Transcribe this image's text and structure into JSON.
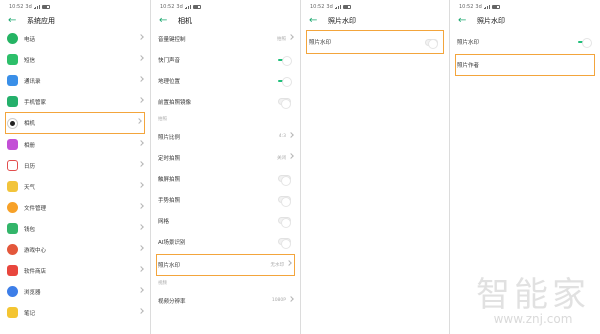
{
  "status": {
    "time": "10:52",
    "network": "3d"
  },
  "screen1": {
    "title": "系统应用",
    "items": [
      {
        "label": "电话",
        "icon": "phone-icon",
        "color": "#25b464"
      },
      {
        "label": "短信",
        "icon": "message-icon",
        "color": "#2dbf6a"
      },
      {
        "label": "通讯录",
        "icon": "contacts-icon",
        "color": "#3a8fe8"
      },
      {
        "label": "手机管家",
        "icon": "shield-icon",
        "color": "#24b06b"
      },
      {
        "label": "相机",
        "icon": "camera-icon",
        "color": "#222222"
      },
      {
        "label": "相册",
        "icon": "gallery-icon",
        "color": "#c34fd6"
      },
      {
        "label": "日历",
        "icon": "calendar-icon",
        "color": "#e24e4e"
      },
      {
        "label": "天气",
        "icon": "weather-icon",
        "color": "#f2c43b"
      },
      {
        "label": "文件管理",
        "icon": "folder-icon",
        "color": "#f7a128"
      },
      {
        "label": "钱包",
        "icon": "wallet-icon",
        "color": "#33b56a"
      },
      {
        "label": "游戏中心",
        "icon": "game-icon",
        "color": "#e3573b"
      },
      {
        "label": "软件商店",
        "icon": "store-icon",
        "color": "#e8463d"
      },
      {
        "label": "浏览器",
        "icon": "browser-icon",
        "color": "#3d7ee8"
      },
      {
        "label": "笔记",
        "icon": "notes-icon",
        "color": "#f4c532"
      }
    ]
  },
  "screen2": {
    "title": "相机",
    "items": [
      {
        "label": "音量键控制",
        "value": "拍照"
      },
      {
        "label": "快门声音"
      },
      {
        "label": "地理位置"
      },
      {
        "label": "前置拍照镜像"
      }
    ],
    "section": "拍照",
    "items2": [
      {
        "label": "照片比例",
        "value": "4:3"
      },
      {
        "label": "定时拍照",
        "value": "关闭"
      },
      {
        "label": "触屏拍照"
      },
      {
        "label": "手势拍照"
      },
      {
        "label": "网格"
      },
      {
        "label": "AI场景识别"
      },
      {
        "label": "照片水印",
        "value": "无水印"
      }
    ],
    "section2": "视频",
    "items3": [
      {
        "label": "视频分辨率",
        "value": "1080P"
      }
    ]
  },
  "screen3": {
    "title": "照片水印",
    "item": "照片水印"
  },
  "screen4": {
    "title": "照片水印",
    "item": "照片水印",
    "author": "照片作者"
  },
  "watermark": {
    "main": "智能家",
    "sub": "www.znj.com"
  },
  "colors": {
    "accent": "#1fbf7a",
    "highlight": "#f3a53c"
  }
}
